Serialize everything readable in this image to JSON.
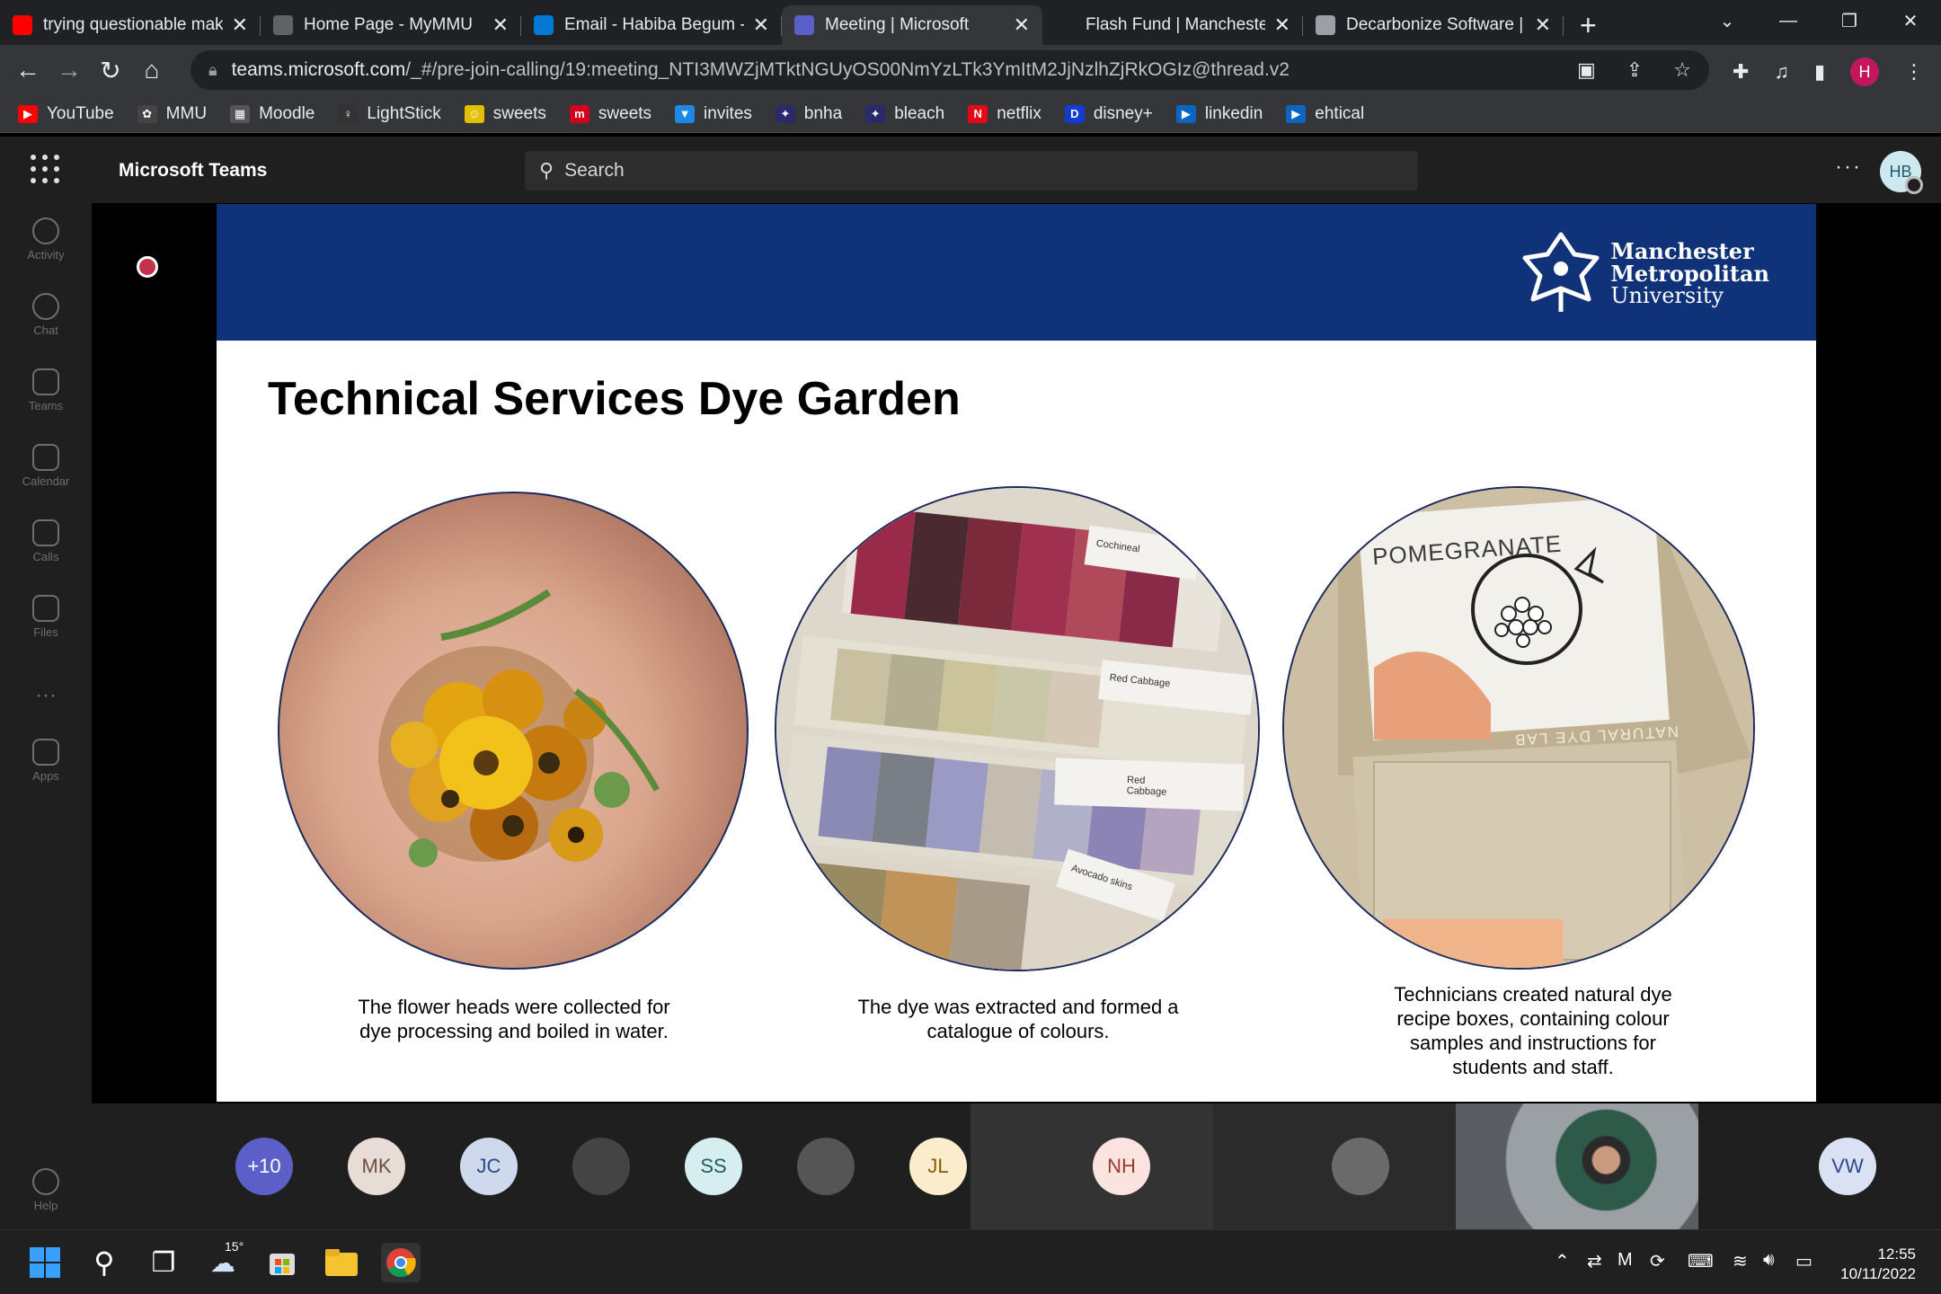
{
  "browser": {
    "tabs": [
      {
        "title": "trying questionable mak",
        "icon": "youtube-icon",
        "color": "#ff0000",
        "active": false
      },
      {
        "title": "Home Page - MyMMU",
        "icon": "mmu-icon",
        "color": "#5f6368",
        "active": false
      },
      {
        "title": "Email - Habiba Begum -",
        "icon": "outlook-icon",
        "color": "#0078d4",
        "active": false
      },
      {
        "title": "Meeting | Microsoft",
        "icon": "teams-icon",
        "color": "#5b5fc7",
        "active": true
      },
      {
        "title": "Flash Fund | Manchester",
        "icon": "blank-icon",
        "color": "#202124",
        "active": false
      },
      {
        "title": "Decarbonize Software | (",
        "icon": "site-icon",
        "color": "#9aa0a6",
        "active": false
      }
    ],
    "url_host": "teams.microsoft.com",
    "url_path": "/_#/pre-join-calling/19:meeting_NTI3MWZjMTktNGUyOS00NmYzLTk3YmItM2JjNzlhZjRkOGIz@thread.v2",
    "profile_initial": "H",
    "bookmarks": [
      {
        "label": "YouTube",
        "color": "#ff0000",
        "glyph": "▶"
      },
      {
        "label": "MMU",
        "color": "#444444",
        "glyph": "✿"
      },
      {
        "label": "Moodle",
        "color": "#555555",
        "glyph": "▦"
      },
      {
        "label": "LightStick",
        "color": "#333333",
        "glyph": "♀"
      },
      {
        "label": "sweets",
        "color": "#e0c000",
        "glyph": "☺"
      },
      {
        "label": "sweets",
        "color": "#d1001f",
        "glyph": "m"
      },
      {
        "label": "invites",
        "color": "#1e88e5",
        "glyph": "▼"
      },
      {
        "label": "bnha",
        "color": "#2a2a6a",
        "glyph": "✦"
      },
      {
        "label": "bleach",
        "color": "#2a2a6a",
        "glyph": "✦"
      },
      {
        "label": "netflix",
        "color": "#e50914",
        "glyph": "N"
      },
      {
        "label": "disney+",
        "color": "#113ccf",
        "glyph": "D"
      },
      {
        "label": "linkedin",
        "color": "#0a66c2",
        "glyph": "▶"
      },
      {
        "label": "ehtical",
        "color": "#0a66c2",
        "glyph": "▶"
      }
    ]
  },
  "teams": {
    "app_title": "Microsoft Teams",
    "search_placeholder": "Search",
    "user_initials": "HB",
    "rail": [
      {
        "label": "Activity",
        "icon": "bell-icon"
      },
      {
        "label": "Chat",
        "icon": "chat-icon"
      },
      {
        "label": "Teams",
        "icon": "teams-group-icon"
      },
      {
        "label": "Calendar",
        "icon": "calendar-icon"
      },
      {
        "label": "Calls",
        "icon": "phone-icon"
      },
      {
        "label": "Files",
        "icon": "file-icon"
      },
      {
        "label": "Apps",
        "icon": "apps-icon"
      },
      {
        "label": "Help",
        "icon": "help-icon"
      }
    ],
    "rail_more": "···",
    "participants": [
      {
        "initials": "+10",
        "bg": "#5b5fc7",
        "fg": "#ffffff"
      },
      {
        "initials": "MK",
        "bg": "#e8dcd6",
        "fg": "#6b4e3d"
      },
      {
        "initials": "JC",
        "bg": "#cfd9ee",
        "fg": "#2b4a8a"
      },
      {
        "initials": "",
        "bg": "#444444",
        "fg": "#ffffff",
        "photo": true
      },
      {
        "initials": "SS",
        "bg": "#d7eef0",
        "fg": "#1f5b63"
      },
      {
        "initials": "",
        "bg": "#555555",
        "fg": "#ffffff",
        "photo": true
      },
      {
        "initials": "JL",
        "bg": "#fbeccc",
        "fg": "#8a5a0a"
      },
      {
        "initials": "NH",
        "bg": "#fbe3df",
        "fg": "#9a3b2c"
      },
      {
        "initials": "",
        "bg": "#6a6a6a",
        "fg": "#ffffff",
        "photo": true
      },
      {
        "initials": "VW",
        "bg": "#d9e1f2",
        "fg": "#2b4a8a"
      }
    ]
  },
  "slide": {
    "title": "Technical Services Dye Garden",
    "logo": [
      "Manchester",
      "Metropolitan",
      "University"
    ],
    "captions": [
      "The flower heads were collected for dye processing and boiled in water.",
      "The dye was extracted and formed a catalogue of colours.",
      "Technicians created natural dye recipe boxes, containing colour samples and instructions for students and staff."
    ],
    "swatch_labels": [
      "Cochineal",
      "Red Cabbage",
      "Red Cabbage",
      "Avocado skins"
    ],
    "box_label": "POMEGRANATE",
    "box_lid": "NATURAL DYE LAB"
  },
  "taskbar": {
    "weather": "15°",
    "time": "12:55",
    "date": "10/11/2022"
  }
}
